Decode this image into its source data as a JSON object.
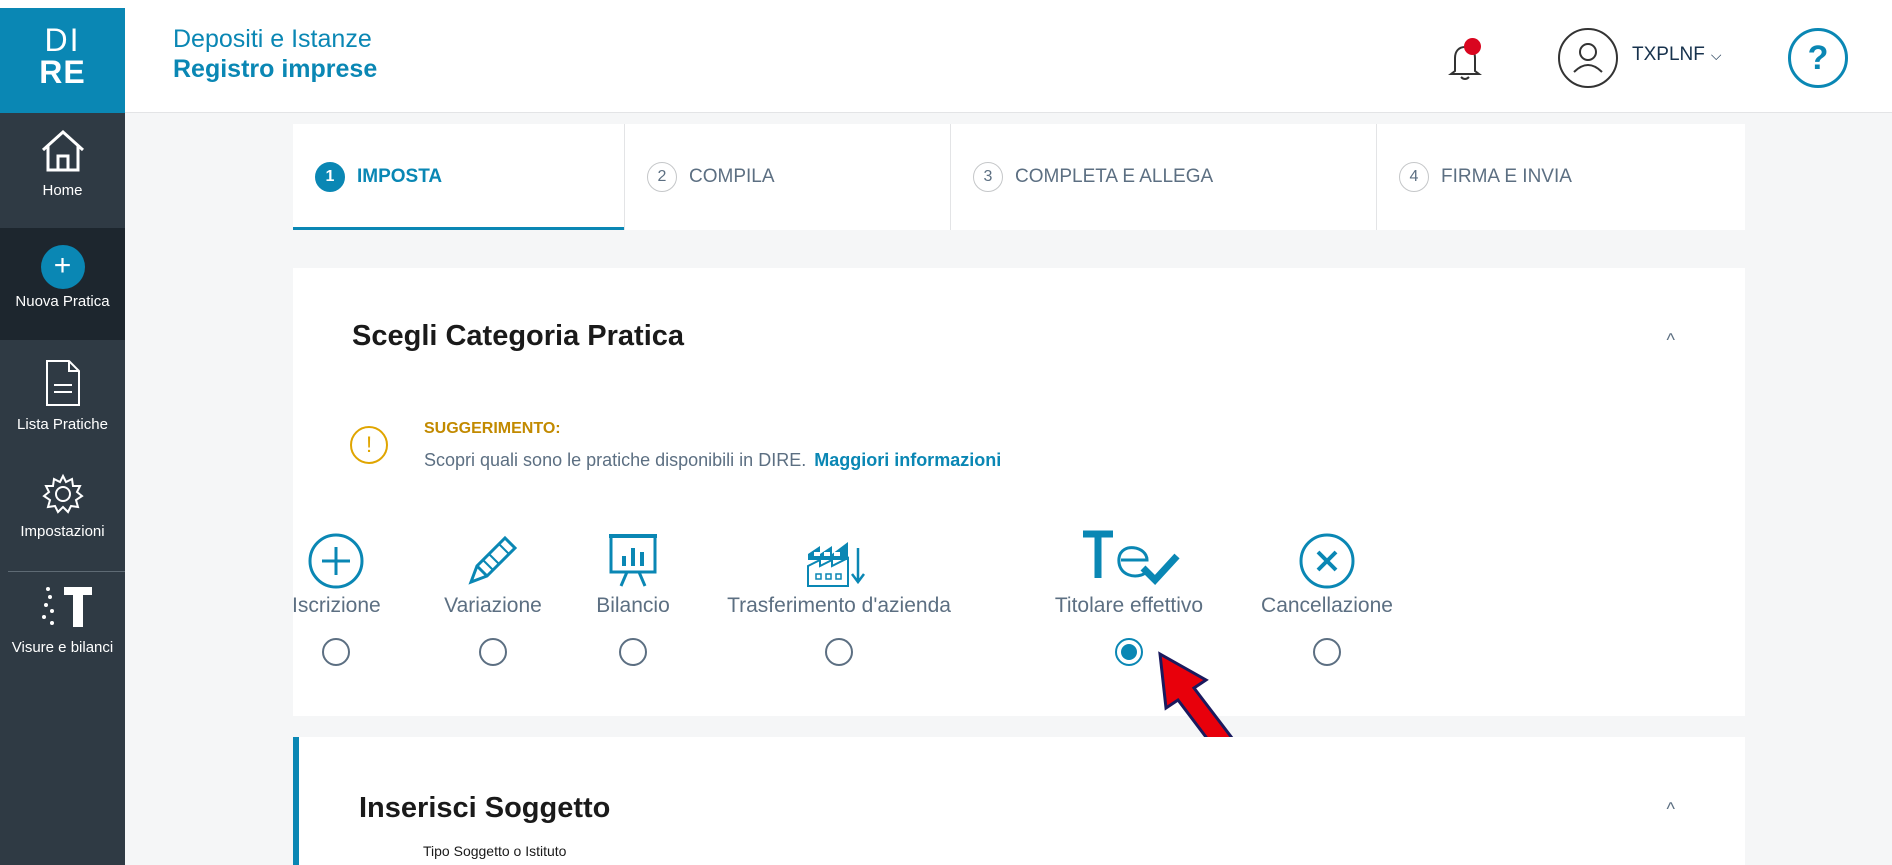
{
  "logo": {
    "line1": "DI",
    "line2": "RE"
  },
  "app": {
    "title1": "Depositi e Istanze",
    "title2": "Registro imprese"
  },
  "header": {
    "username": "TXPLNF",
    "username_chevron": "⌵",
    "help_label": "?"
  },
  "sidebar": {
    "items": [
      {
        "label": "Home",
        "icon": "home-icon"
      },
      {
        "label": "Nuova Pratica",
        "icon": "plus-icon",
        "symbol": "+"
      },
      {
        "label": "Lista Pratiche",
        "icon": "document-icon"
      },
      {
        "label": "Impostazioni",
        "icon": "gear-icon"
      },
      {
        "label": "Visure e bilanci",
        "icon": "visure-icon"
      }
    ]
  },
  "stepper": {
    "steps": [
      {
        "num": "1",
        "label": "IMPOSTA",
        "active": true
      },
      {
        "num": "2",
        "label": "COMPILA"
      },
      {
        "num": "3",
        "label": "COMPLETA E ALLEGA"
      },
      {
        "num": "4",
        "label": "FIRMA E INVIA"
      }
    ]
  },
  "category_card": {
    "title": "Scegli Categoria Pratica",
    "chevron": "^",
    "hint_symbol": "!",
    "hint_title": "SUGGERIMENTO:",
    "hint_text": "Scopri quali sono le pratiche disponibili in DIRE.",
    "hint_link": "Maggiori informazioni",
    "categories": [
      {
        "label": "Iscrizione",
        "icon": "plus-circle-icon"
      },
      {
        "label": "Variazione",
        "icon": "pencil-icon"
      },
      {
        "label": "Bilancio",
        "icon": "chart-board-icon"
      },
      {
        "label": "Trasferimento d'azienda",
        "icon": "factory-icon"
      },
      {
        "label": "Titolare effettivo",
        "icon": "titolare-icon",
        "selected": true
      },
      {
        "label": "Cancellazione",
        "icon": "x-circle-icon"
      }
    ]
  },
  "subject_card": {
    "title": "Inserisci Soggetto",
    "chevron": "^",
    "field_label": "Tipo Soggetto o Istituto"
  },
  "colors": {
    "accent": "#0a87b4",
    "sidebar": "#2f3a44",
    "warning": "#e0a500",
    "arrow": "#e8000b"
  }
}
